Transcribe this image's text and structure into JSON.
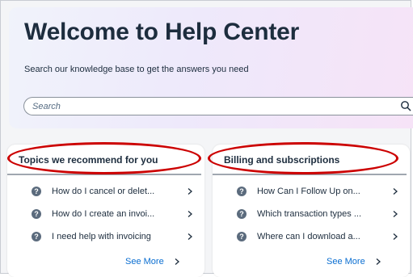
{
  "hero": {
    "title": "Welcome to Help Center",
    "subtitle": "Search our knowledge base to get the answers you need"
  },
  "search": {
    "placeholder": "Search",
    "icon": "search-icon"
  },
  "cards": [
    {
      "title": "Topics we recommend for you",
      "items": [
        {
          "label": "How do I cancel or delet...",
          "icon": "question-circle-icon"
        },
        {
          "label": "How do I create an invoi...",
          "icon": "question-circle-icon"
        },
        {
          "label": "I need help with invoicing",
          "icon": "question-circle-icon"
        }
      ],
      "see_more": "See More"
    },
    {
      "title": "Billing and subscriptions",
      "items": [
        {
          "label": "How Can I Follow Up on...",
          "icon": "question-circle-icon"
        },
        {
          "label": "Which transaction types ...",
          "icon": "question-circle-icon"
        },
        {
          "label": "Where can I download a...",
          "icon": "question-circle-icon"
        }
      ],
      "see_more": "See More"
    }
  ],
  "colors": {
    "title_text": "#1d2d3e",
    "link": "#0a6ed1",
    "highlight_oval": "#cc0000",
    "question_icon": "#5b6b7d"
  }
}
